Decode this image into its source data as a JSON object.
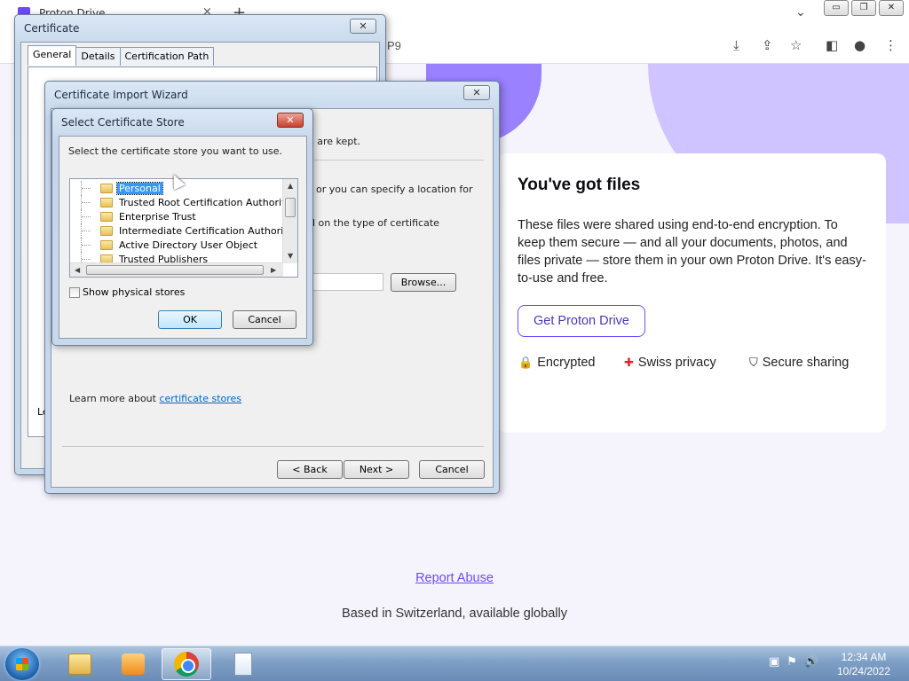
{
  "browser": {
    "tab_title": "Proton Drive",
    "tab_close": "×",
    "new_tab": "+",
    "tab_dropdown": "⌄",
    "url_fragment": "P9",
    "window_controls": {
      "minimize": "▭",
      "restore": "❐",
      "close": "✕"
    },
    "toolbar_icons": [
      "download-icon",
      "share-icon",
      "star-icon",
      "sidepanel-icon",
      "profile-icon",
      "menu-icon"
    ]
  },
  "page": {
    "title": "You've got files",
    "body": "These files were shared using end-to-end encryption. To keep them secure — and all your documents, photos, and files private — store them in your own Proton Drive. It's easy-to-use and free.",
    "cta": "Get Proton Drive",
    "features": [
      {
        "icon": "lock-icon",
        "label": "Encrypted"
      },
      {
        "icon": "swiss-flag-icon",
        "label": "Swiss privacy"
      },
      {
        "icon": "shield-icon",
        "label": "Secure sharing"
      }
    ],
    "report": "Report Abuse",
    "footer": "Based in Switzerland, available globally",
    "accent": "#6d4aff"
  },
  "certificate": {
    "title": "Certificate",
    "tabs": [
      "General",
      "Details",
      "Certification Path"
    ],
    "active_tab": "General",
    "fragment_text": "Le"
  },
  "wizard": {
    "title": "Certificate Import Wizard",
    "text1": "s are kept.",
    "text2": "or you can specify a location for",
    "text3": "d on the type of certificate",
    "browse": "Browse...",
    "learn_prefix": "Learn more about ",
    "learn_link": "certificate stores",
    "back": "< Back",
    "next": "Next >",
    "cancel": "Cancel"
  },
  "store_dialog": {
    "title": "Select Certificate Store",
    "prompt": "Select the certificate store you want to use.",
    "stores": [
      "Personal",
      "Trusted Root Certification Authorities",
      "Enterprise Trust",
      "Intermediate Certification Authorities",
      "Active Directory User Object",
      "Trusted Publishers"
    ],
    "selected": "Personal",
    "show_physical": "Show physical stores",
    "show_physical_checked": false,
    "ok": "OK",
    "cancel": "Cancel"
  },
  "taskbar": {
    "items": [
      "windows-explorer",
      "media-player",
      "chrome",
      "file"
    ],
    "active": "chrome",
    "time": "12:34 AM",
    "date": "10/24/2022"
  }
}
